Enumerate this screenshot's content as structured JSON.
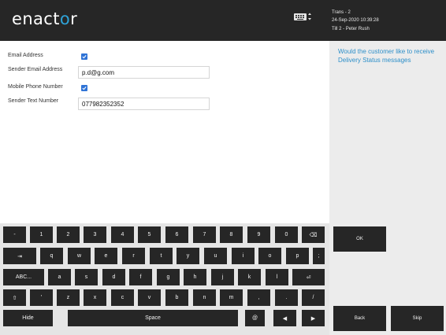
{
  "header": {
    "logo_prefix": "enact",
    "logo_accent": "o",
    "logo_suffix": "r",
    "keyboard_icon": "keyboard-icon",
    "trans": "Trans - 2",
    "datetime": "24-Sep-2020 10:39:28",
    "till": "Till 2 - Peter Rush"
  },
  "prompt": "Would the customer like to receive Delivery Status messages",
  "form": {
    "email_address_label": "Email Address",
    "sender_email_label": "Sender Email Address",
    "sender_email_value": "p.d@g.com",
    "mobile_label": "Mobile Phone Number",
    "sender_text_label": "Sender Text Number",
    "sender_text_value": "077982352352"
  },
  "keyboard": {
    "row1": [
      "-",
      "1",
      "2",
      "3",
      "4",
      "5",
      "6",
      "7",
      "8",
      "9",
      "0",
      "⌫"
    ],
    "row2": [
      "⇥",
      "q",
      "w",
      "e",
      "r",
      "t",
      "y",
      "u",
      "i",
      "o",
      "p",
      ";"
    ],
    "row3_abc": "ABC...",
    "row3": [
      "a",
      "s",
      "d",
      "f",
      "g",
      "h",
      "j",
      "k",
      "l"
    ],
    "row3_enter": "⏎",
    "row4": [
      "⇧",
      "'",
      "z",
      "x",
      "c",
      "v",
      "b",
      "n",
      "m",
      ",",
      ".",
      "/"
    ],
    "hide": "Hide",
    "space": "Space",
    "at": "@",
    "left_arrow": "◀",
    "right_arrow": "▶"
  },
  "actions": {
    "ok": "OK",
    "back": "Back",
    "skip": "Skip"
  },
  "colors": {
    "header_bg": "#262626",
    "accent": "#2ea3d8",
    "prompt_text": "#2d8fc9",
    "checkbox": "#2f73d6",
    "key_bg": "#262626"
  }
}
